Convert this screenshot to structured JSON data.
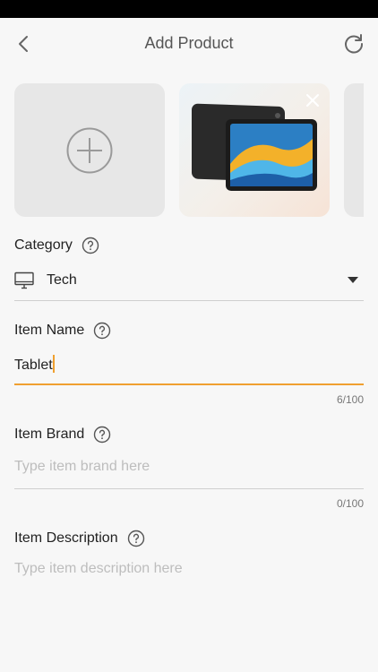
{
  "header": {
    "title": "Add Product"
  },
  "photos": {
    "add_icon": "plus-circle-icon",
    "items": [
      {
        "description": "tablet product photo",
        "remove_icon": "close-icon"
      }
    ]
  },
  "category": {
    "label": "Category",
    "value": "Tech",
    "icon": "monitor-icon"
  },
  "item_name": {
    "label": "Item Name",
    "value": "Tablet",
    "counter": "6/100"
  },
  "item_brand": {
    "label": "Item Brand",
    "placeholder": "Type item brand here",
    "counter": "0/100"
  },
  "item_description": {
    "label": "Item Description",
    "placeholder": "Type item description here"
  },
  "colors": {
    "accent": "#f0a030",
    "background": "#f7f7f7"
  }
}
